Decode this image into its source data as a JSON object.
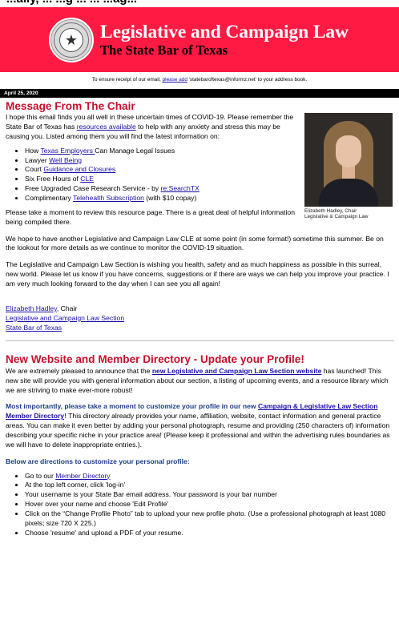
{
  "top_strip": "...ally, ... ...g ... ... ...ag...",
  "banner": {
    "title": "Legislative and Campaign Law",
    "subtitle": "The State Bar of Texas",
    "seal_icon": "state-bar-seal"
  },
  "receipt": {
    "before": "To ensure receipt of our email, ",
    "link": "please add",
    "after": " 'statebaroftexas@informz.net' to your address book."
  },
  "date": "April 25, 2020",
  "chair_message": {
    "heading": "Message From The Chair",
    "intro_1": "I hope this email finds you all well in these uncertain times of COVID-19. Please remember the State Bar of Texas has ",
    "intro_link": "resources available",
    "intro_2": " to help with any anxiety and stress this may be causing you. Listed among them you will find the latest information on:",
    "bullets": [
      {
        "pre": "How ",
        "link": "Texas Employers ",
        "post": "Can Manage Legal Issues"
      },
      {
        "pre": "Lawyer ",
        "link": "Well Being",
        "post": ""
      },
      {
        "pre": "Court ",
        "link": "Guidance and Closures",
        "post": ""
      },
      {
        "pre": "Six Free Hours of ",
        "link": "CLE",
        "post": ""
      },
      {
        "pre": "Free Upgraded Case Research Service - by ",
        "link": "re:SearchTX",
        "post": ""
      },
      {
        "pre": "Complimentary ",
        "link": "Telehealth Subscription",
        "post": " (with $10 copay)"
      }
    ],
    "para_review": "Please take a moment to review this resource page. There is a great deal of helpful information being compiled there.",
    "para_cle": "We hope to have another Legislative and Campaign Law CLE at some point (in some format!) sometime this summer. Be on the lookout for more details as we continue to monitor the COVID-19 situation.",
    "para_wish": "The Legislative and Campaign Law Section is wishing you health, safety and as much happiness as possible in this surreal, new world. Please let us know if you have concerns, suggestions or if there are ways we can help you improve your practice. I am very much looking forward to the day when I can see you all again!",
    "photo_caption_1": "Elizabeth Hadley, Chair",
    "photo_caption_2": "Legislative & Campaign Law",
    "signature": {
      "name_link": "Elizabeth Hadley",
      "name_suffix": ", Chair",
      "section_link": "Legislative and Campaign Law Section",
      "bar_link": "State Bar of Texas"
    }
  },
  "website": {
    "heading": "New Website and Member Directory - Update your Profile!",
    "para1_a": "We are extremely pleased to announce that the ",
    "para1_link": "new Legislative and Campaign Law Section website",
    "para1_b": " has launched! This new site will provide you with general information about our section, a listing of upcoming events, and a resource library which we are striving to make ever-more robust!",
    "para2_bold": "Most importantly, please take a moment to customize your profile in our new ",
    "para2_link": "Campaign & Legislative Law Section Member Directory",
    "para2_bang": "!",
    "para2_rest": " This directory already provides your name, affiliation, website, contact information and general practice areas. You can make it even better by adding your personal photograph, resume and providing (250 characters of) information describing your specific niche in your practice area! (Please keep it professional and within the advertising rules boundaries as we will have to delete inappropriate entries.).",
    "directions_heading": "Below are directions to customize your personal profile:",
    "steps": [
      {
        "pre": "Go to our ",
        "link": "Member Directory",
        "post": ""
      },
      {
        "pre": "At the top left corner, click 'log-in'",
        "link": "",
        "post": ""
      },
      {
        "pre": "Your username is your State Bar email address. Your password is your bar number",
        "link": "",
        "post": ""
      },
      {
        "pre": "Hover over your name and choose 'Edit Profile'",
        "link": "",
        "post": ""
      },
      {
        "pre": "Click on the “Change Profile Photo” tab to upload your new profile photo. (Use a professional photograph at least 1080 pixels; size 720 X 225.)",
        "link": "",
        "post": ""
      },
      {
        "pre": "Choose 'resume' and upload a PDF of your resume.",
        "link": "",
        "post": ""
      }
    ]
  },
  "colors": {
    "banner_bg": "#ff1a44",
    "heading_red": "#c8102e",
    "link_blue": "#1a0dab",
    "date_bar": "#000000"
  }
}
